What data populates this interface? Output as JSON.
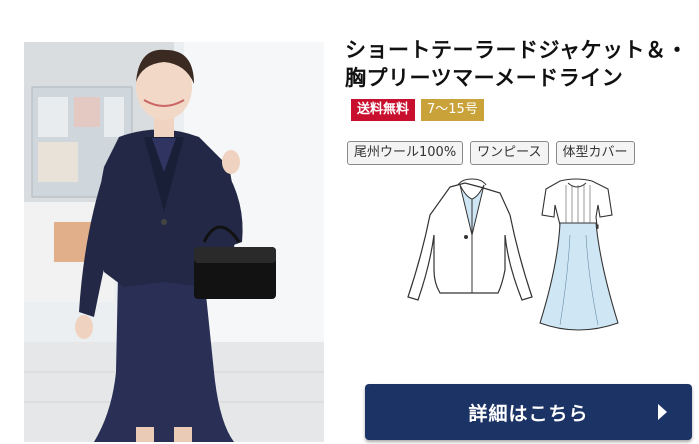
{
  "product": {
    "title_line1": "ショートテーラードジャケット＆・",
    "title_line2": "胸プリーツマーメードライン",
    "badges": {
      "shipping": "送料無料",
      "sizes": "7～15号"
    },
    "tags": [
      "尾州ウール100%",
      "ワンピース",
      "体型カバー"
    ],
    "cta_label": "詳細はこちら"
  },
  "icons": {
    "jacket": "jacket-sketch-icon",
    "dress": "dress-sketch-icon",
    "arrow": "chevron-right-icon"
  },
  "colors": {
    "badge_red": "#c8102e",
    "badge_gold": "#c9a23a",
    "cta_navy": "#1c3366",
    "sketch_blue": "#cfe6f5"
  }
}
